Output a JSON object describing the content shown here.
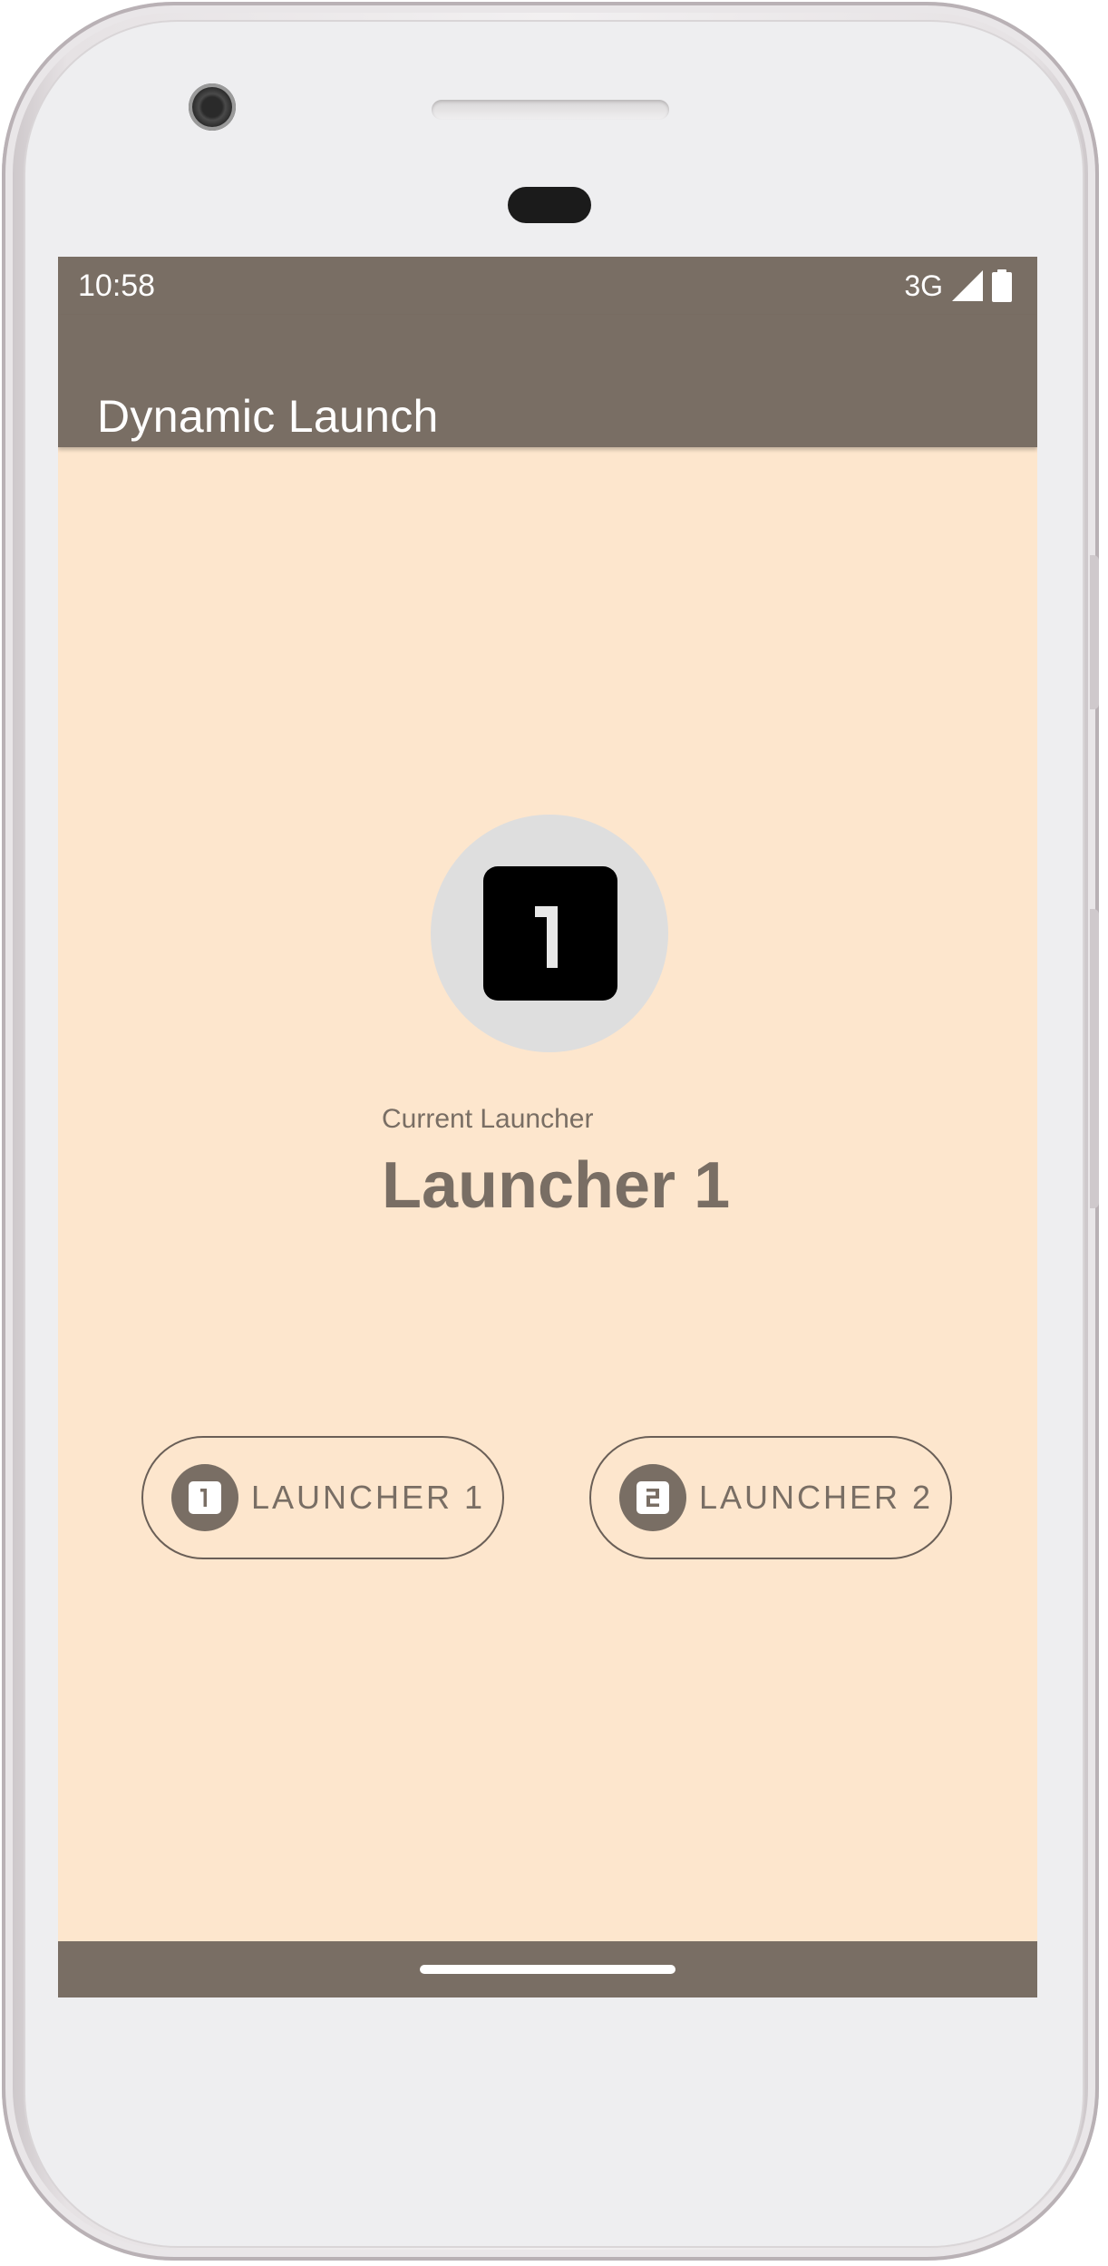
{
  "status_bar": {
    "time": "10:58",
    "network": "3G",
    "signal_icon": "signal-icon",
    "battery_icon": "battery-icon"
  },
  "app_bar": {
    "title": "Dynamic Launch"
  },
  "current_launcher": {
    "label": "Current Launcher",
    "value": "Launcher 1",
    "icon": "launcher-1-icon"
  },
  "buttons": [
    {
      "label": "LAUNCHER 1",
      "icon": "launcher-1-icon"
    },
    {
      "label": "LAUNCHER 2",
      "icon": "launcher-2-icon"
    }
  ],
  "colors": {
    "primary": "#796e64",
    "background": "#fde6cd",
    "badge_background": "#dedede",
    "on_primary": "#ffffff"
  }
}
